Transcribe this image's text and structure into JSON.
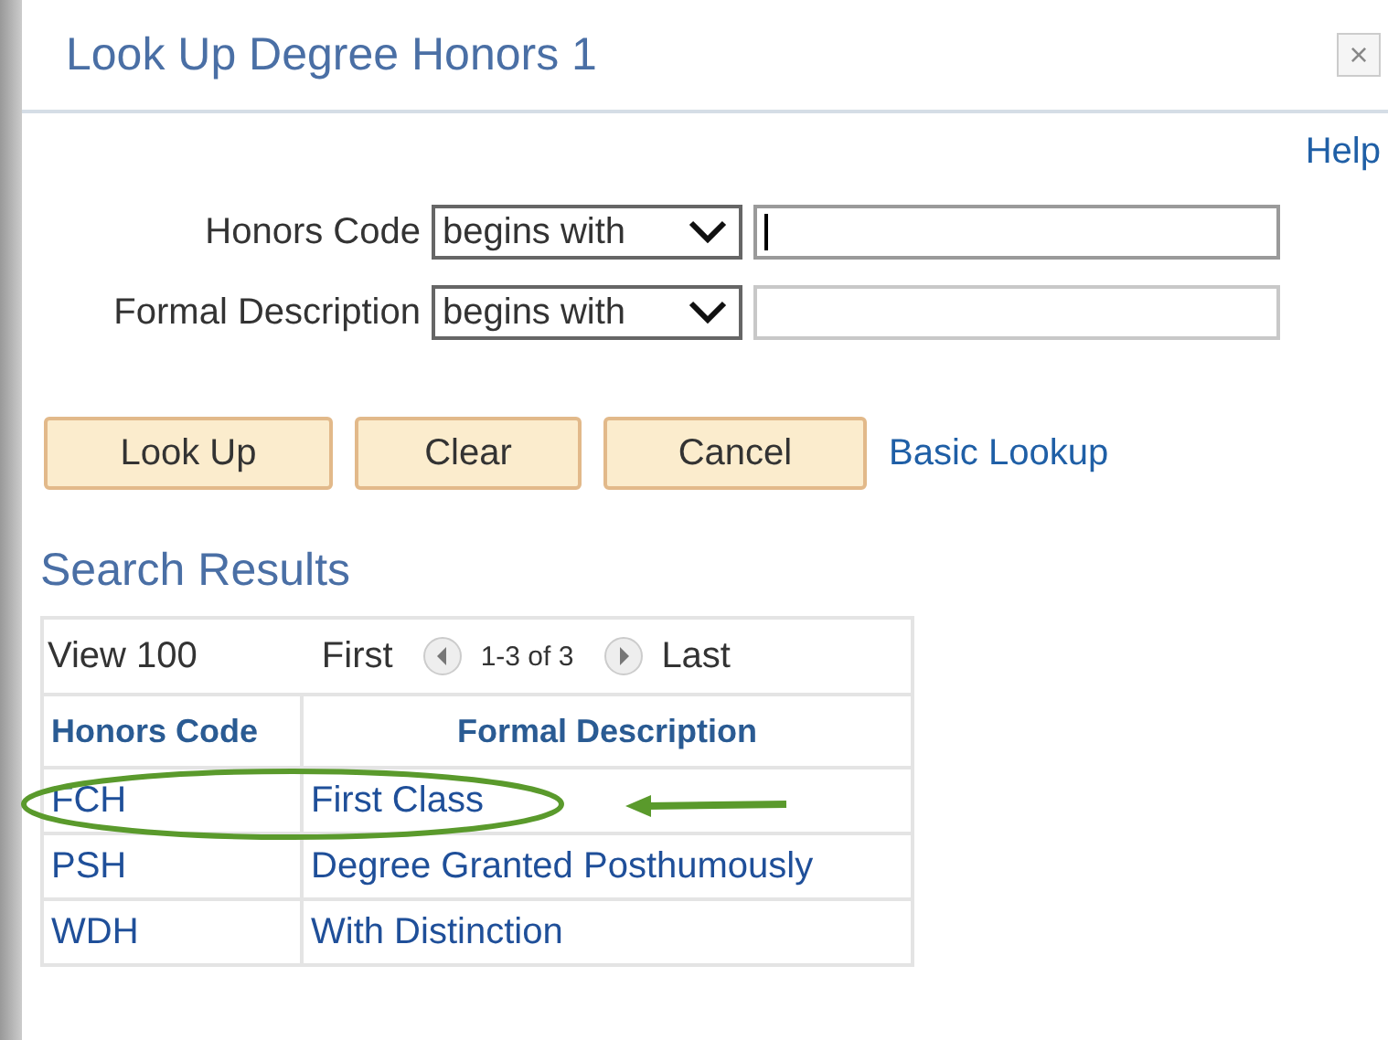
{
  "window": {
    "title": "Look Up Degree Honors 1",
    "close": "×"
  },
  "help": "Help",
  "criteria": [
    {
      "label": "Honors Code",
      "operator": "begins with",
      "focused": true
    },
    {
      "label": "Formal Description",
      "operator": "begins with",
      "focused": false
    }
  ],
  "buttons": [
    "Look Up",
    "Clear",
    "Cancel"
  ],
  "basic_lookup": "Basic Lookup",
  "results": {
    "title": "Search Results",
    "nav": {
      "view": "View 100",
      "first": "First",
      "range": "1-3 of 3",
      "last": "Last"
    },
    "columns": [
      "Honors Code",
      "Formal Description"
    ],
    "rows": [
      {
        "code": "FCH",
        "description": "First Class",
        "highlighted": true
      },
      {
        "code": "PSH",
        "description": "Degree Granted Posthumously",
        "highlighted": false
      },
      {
        "code": "WDH",
        "description": "With Distinction",
        "highlighted": false
      }
    ]
  }
}
